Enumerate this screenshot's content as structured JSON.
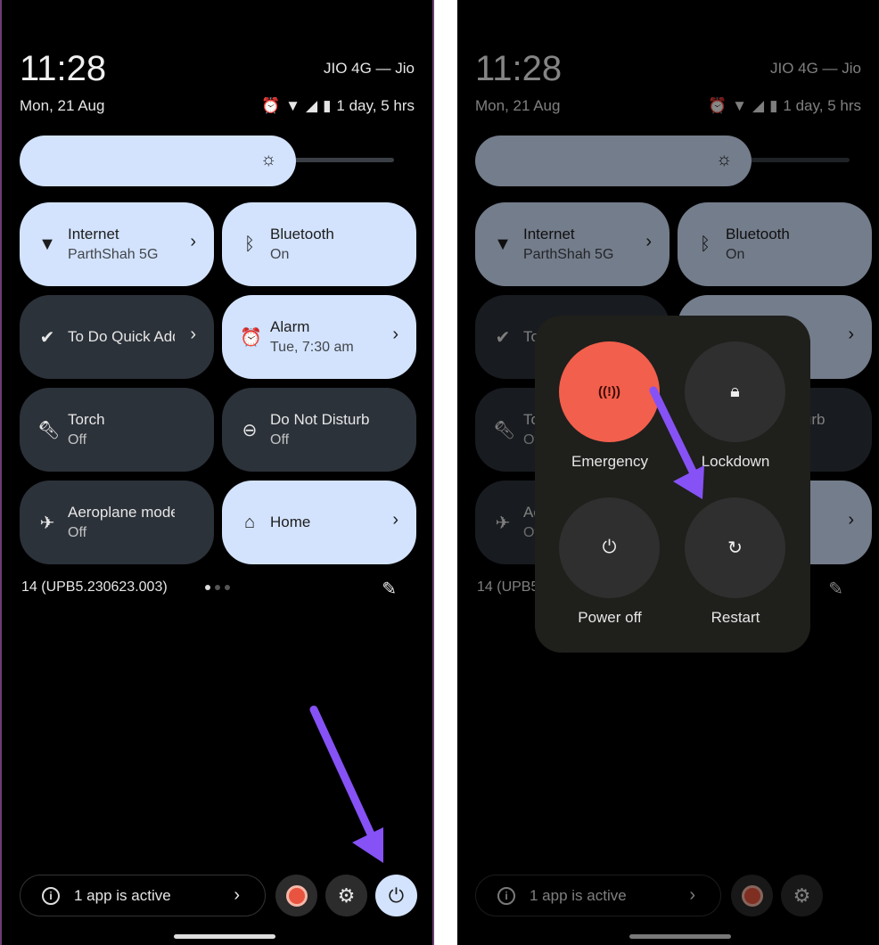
{
  "status": {
    "time": "11:28",
    "carrier": "JIO 4G — Jio",
    "date": "Mon, 21 Aug",
    "battery": "1 day, 5 hrs",
    "icons": [
      "alarm-icon",
      "wifi-icon",
      "signal-icon",
      "battery-icon"
    ]
  },
  "brightness": {
    "level_percent": 73,
    "icon": "brightness-icon"
  },
  "tiles": [
    {
      "label": "Internet",
      "sub": "ParthShah 5G",
      "icon": "wifi-icon",
      "on": true,
      "chevron": true
    },
    {
      "label": "Bluetooth",
      "sub": "On",
      "icon": "bluetooth-icon",
      "on": true,
      "chevron": false
    },
    {
      "label": "To Do Quick Add",
      "sub": "",
      "icon": "check-icon",
      "on": false,
      "chevron": true
    },
    {
      "label": "Alarm",
      "sub": "Tue, 7:30 am",
      "icon": "alarm-icon",
      "on": true,
      "chevron": true
    },
    {
      "label": "Torch",
      "sub": "Off",
      "icon": "torch-icon",
      "on": false,
      "chevron": false
    },
    {
      "label": "Do Not Disturb",
      "sub": "Off",
      "icon": "dnd-icon",
      "on": false,
      "chevron": false
    },
    {
      "label": "Aeroplane mode",
      "sub": "Off",
      "icon": "airplane-icon",
      "on": false,
      "chevron": false
    },
    {
      "label": "Home",
      "sub": "",
      "icon": "home-icon",
      "on": true,
      "chevron": true
    }
  ],
  "build": "14 (UPB5.230623.003)",
  "page_indicator": {
    "current": 1,
    "total": 3
  },
  "footer": {
    "active_apps": "1 app is active"
  },
  "power_menu": {
    "emergency": "Emergency",
    "lockdown": "Lockdown",
    "power_off": "Power off",
    "restart": "Restart"
  },
  "colors": {
    "tile_on": "#d3e3fd",
    "tile_off": "#2c323a",
    "emergency": "#f25f4c",
    "arrow": "#8652f5"
  }
}
